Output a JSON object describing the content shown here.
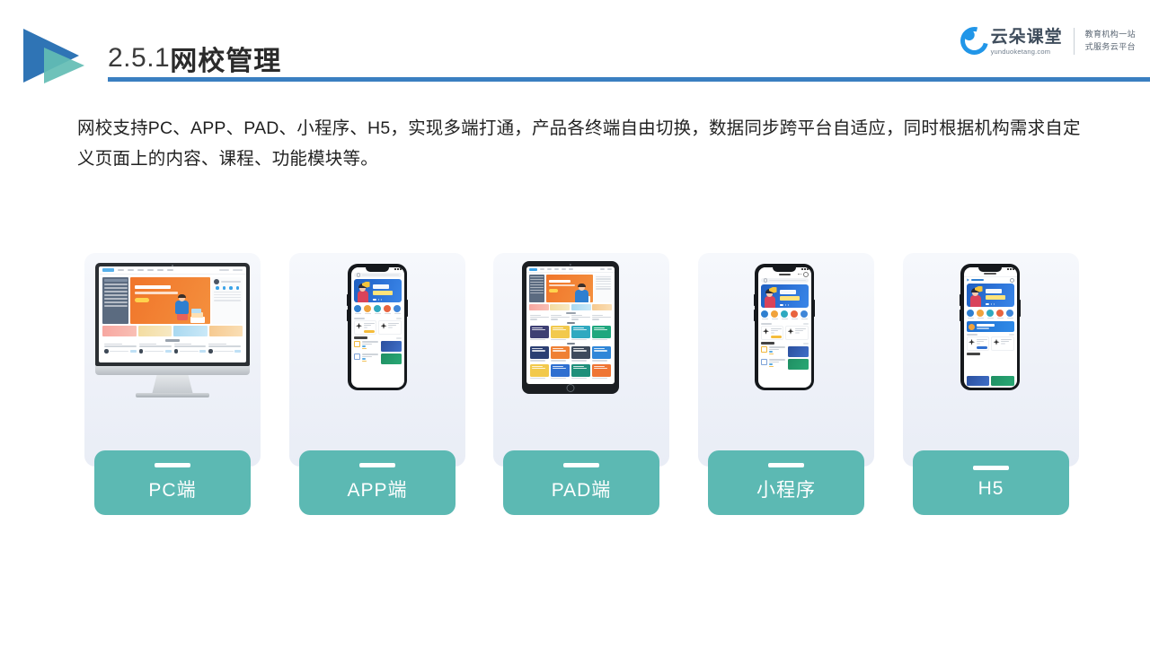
{
  "header": {
    "section_number": "2.5.1",
    "title": "网校管理",
    "logo_icon": "double-triangle-play-icon",
    "rule_color": "#3a7fc1"
  },
  "brand": {
    "icon": "cloud-icon",
    "name_cn": "云朵课堂",
    "name_en": "yunduoketang.com",
    "tagline_line1": "教育机构一站",
    "tagline_line2": "式服务云平台",
    "color": "#2196e8"
  },
  "body": {
    "paragraph": "网校支持PC、APP、PAD、小程序、H5，实现多端打通，产品各终端自由切换，数据同步跨平台自适应，同时根据机构需求自定义页面上的内容、课程、功能模块等。"
  },
  "accent": {
    "teal": "#5cb9b3",
    "blue": "#2f74b5",
    "card_bg": "#eef1f8",
    "orange": "#f0752a"
  },
  "cards": [
    {
      "label": "PC端",
      "device": "desktop-monitor",
      "device_icon": "imac-icon"
    },
    {
      "label": "APP端",
      "device": "smartphone",
      "device_icon": "phone-icon"
    },
    {
      "label": "PAD端",
      "device": "tablet",
      "device_icon": "tablet-icon"
    },
    {
      "label": "小程序",
      "device": "smartphone",
      "device_icon": "phone-icon"
    },
    {
      "label": "H5",
      "device": "smartphone",
      "device_icon": "phone-icon"
    }
  ]
}
